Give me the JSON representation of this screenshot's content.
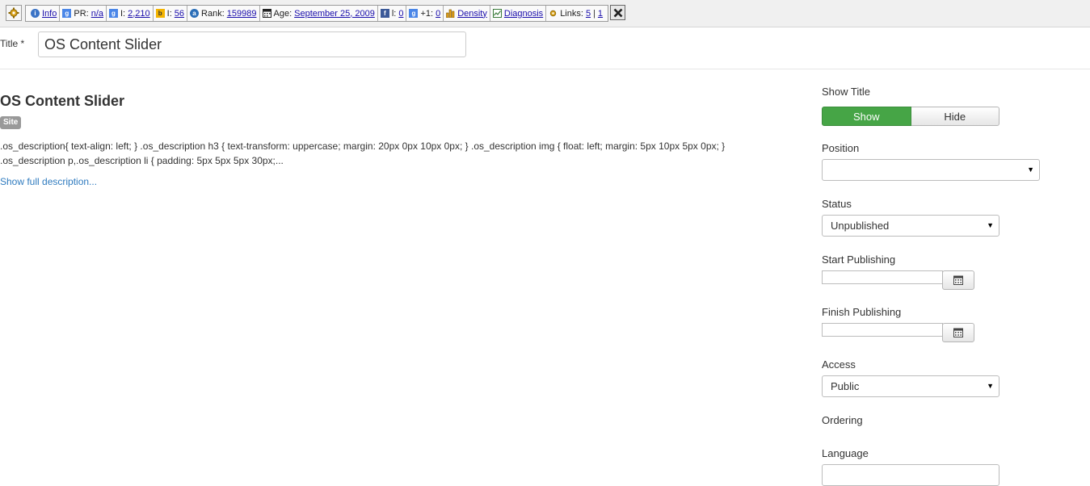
{
  "seo_toolbar": {
    "info_label": "Info",
    "pr_label": "PR:",
    "pr_value": "n/a",
    "google_index_label": "I:",
    "google_index_value": "2,210",
    "bing_index_label": "I:",
    "bing_index_value": "56",
    "rank_label": "Rank:",
    "rank_value": "159989",
    "age_label": "Age:",
    "age_value": "September 25, 2009",
    "fb_label": "l:",
    "fb_value": "0",
    "gplus_label": "+1:",
    "gplus_value": "0",
    "density_label": "Density",
    "diagnosis_label": "Diagnosis",
    "links_label": "Links:",
    "links_value_1": "5",
    "links_sep": "|",
    "links_value_2": "1",
    "icons": [
      "gear-icon",
      "info-icon",
      "pagerank-icon",
      "google-icon",
      "bing-icon",
      "alexa-icon",
      "calendar-icon",
      "facebook-icon",
      "google-plus-icon",
      "density-icon",
      "diagnosis-icon",
      "links-gear-icon",
      "close-icon"
    ]
  },
  "title_field": {
    "label": "Title *",
    "value": "OS Content Slider"
  },
  "module": {
    "title": "OS Content Slider",
    "badge": "Site",
    "description_line1": ".os_description{ text-align: left; } .os_description h3 { text-transform: uppercase; margin: 20px 0px 10px 0px; } .os_description img { float: left; margin: 5px 10px 5px 0px; }",
    "description_line2": ".os_description p,.os_description li { padding: 5px 5px 5px 30px;...",
    "show_full_link": "Show full description..."
  },
  "sidebar": {
    "show_title_label": "Show Title",
    "show_button": "Show",
    "hide_button": "Hide",
    "position_label": "Position",
    "position_value": "",
    "status_label": "Status",
    "status_value": "Unpublished",
    "start_publishing_label": "Start Publishing",
    "start_publishing_value": "",
    "finish_publishing_label": "Finish Publishing",
    "finish_publishing_value": "",
    "access_label": "Access",
    "access_value": "Public",
    "ordering_label": "Ordering",
    "language_label": "Language"
  },
  "colors": {
    "show_active": "#46a546",
    "link": "#2f7bbf",
    "badge": "#999999",
    "toolbar_link": "#1a0dab"
  }
}
